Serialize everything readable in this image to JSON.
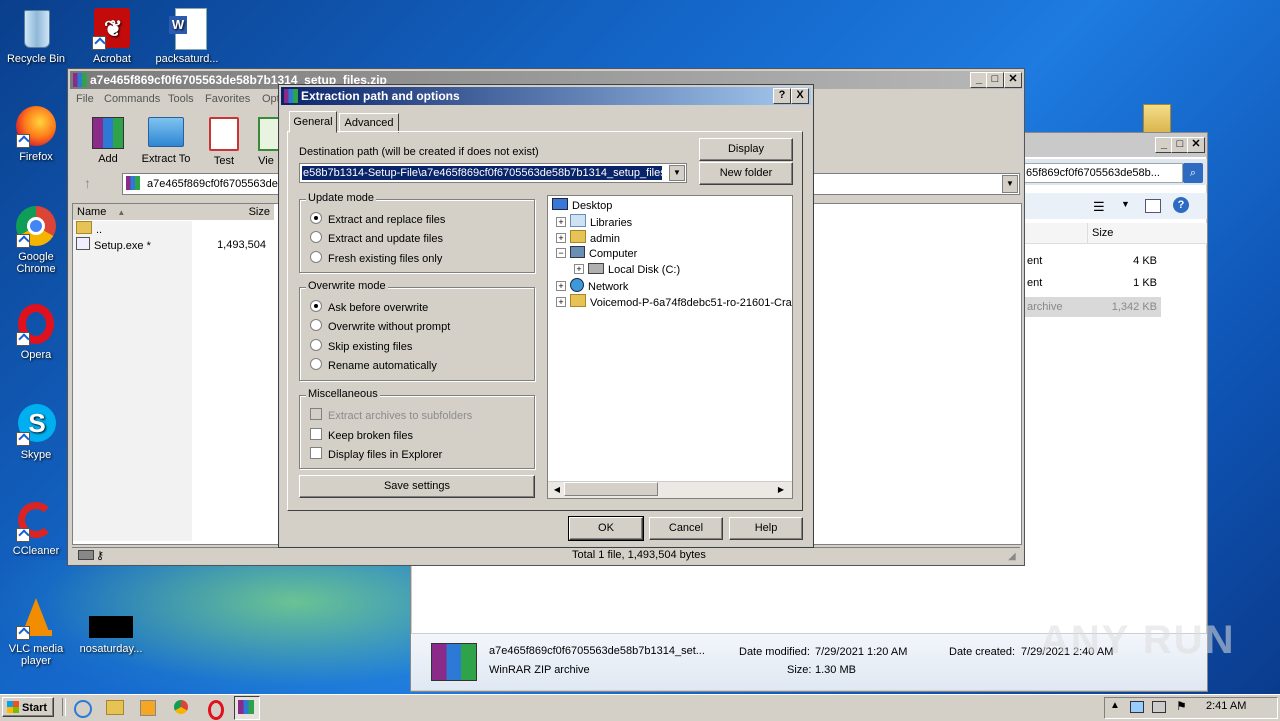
{
  "desktop": {
    "icons": [
      {
        "label": "Recycle Bin"
      },
      {
        "label": "Acrobat"
      },
      {
        "label": "packsaturd..."
      },
      {
        "label": "Firefox"
      },
      {
        "label": "Google Chrome"
      },
      {
        "label": "Opera"
      },
      {
        "label": "Skype"
      },
      {
        "label": "CCleaner"
      },
      {
        "label": "VLC media player"
      },
      {
        "label": "nosaturday..."
      }
    ]
  },
  "winrar": {
    "title": "a7e465f869cf0f6705563de58b7b1314_setup_files.zip",
    "menu": [
      "File",
      "Commands",
      "Tools",
      "Favorites",
      "Opt"
    ],
    "toolbar": [
      "Add",
      "Extract To",
      "Test",
      "Vie"
    ],
    "address": "a7e465f869cf0f6705563de",
    "columns": {
      "name": "Name",
      "size": "Size"
    },
    "rows": [
      {
        "name": "..",
        "size": ""
      },
      {
        "name": "Setup.exe *",
        "size": "1,493,504"
      }
    ],
    "status": "Total 1 file, 1,493,504 bytes"
  },
  "explorer": {
    "search_value": "65f869cf0f6705563de58b...",
    "columns": {
      "type": "",
      "size": "Size"
    },
    "rows": [
      {
        "type": "ent",
        "size": "4 KB"
      },
      {
        "type": "ent",
        "size": "1 KB"
      },
      {
        "type": "archive",
        "size": "1,342 KB"
      }
    ],
    "details": {
      "filename": "a7e465f869cf0f6705563de58b7b1314_set...",
      "filetype": "WinRAR ZIP archive",
      "modified_label": "Date modified:",
      "modified_value": "7/29/2021 1:20 AM",
      "created_label": "Date created:",
      "created_value": "7/29/2021 2:40 AM",
      "size_label": "Size:",
      "size_value": "1.30 MB"
    }
  },
  "dialog": {
    "title": "Extraction path and options",
    "help_btn": "?",
    "close_btn": "X",
    "tabs": [
      "General",
      "Advanced"
    ],
    "dest_label": "Destination path (will be created if does not exist)",
    "dest_value": "e58b7b1314-Setup-File\\a7e465f869cf0f6705563de58b7b1314_setup_files",
    "display_btn": "Display",
    "new_folder_btn": "New folder",
    "update_mode": {
      "title": "Update mode",
      "options": [
        "Extract and replace files",
        "Extract and update files",
        "Fresh existing files only"
      ],
      "selected": 0
    },
    "overwrite_mode": {
      "title": "Overwrite mode",
      "options": [
        "Ask before overwrite",
        "Overwrite without prompt",
        "Skip existing files",
        "Rename automatically"
      ],
      "selected": 0
    },
    "misc": {
      "title": "Miscellaneous",
      "options": [
        "Extract archives to subfolders",
        "Keep broken files",
        "Display files in Explorer"
      ]
    },
    "save_settings": "Save settings",
    "tree": [
      "Desktop",
      "Libraries",
      "admin",
      "Computer",
      "Local Disk (C:)",
      "Network",
      "Voicemod-P-6a74f8debc51-ro-21601-Crac"
    ],
    "ok": "OK",
    "cancel": "Cancel",
    "help": "Help"
  },
  "taskbar": {
    "start": "Start",
    "time": "2:41 AM"
  },
  "watermark": "ANY RUN"
}
